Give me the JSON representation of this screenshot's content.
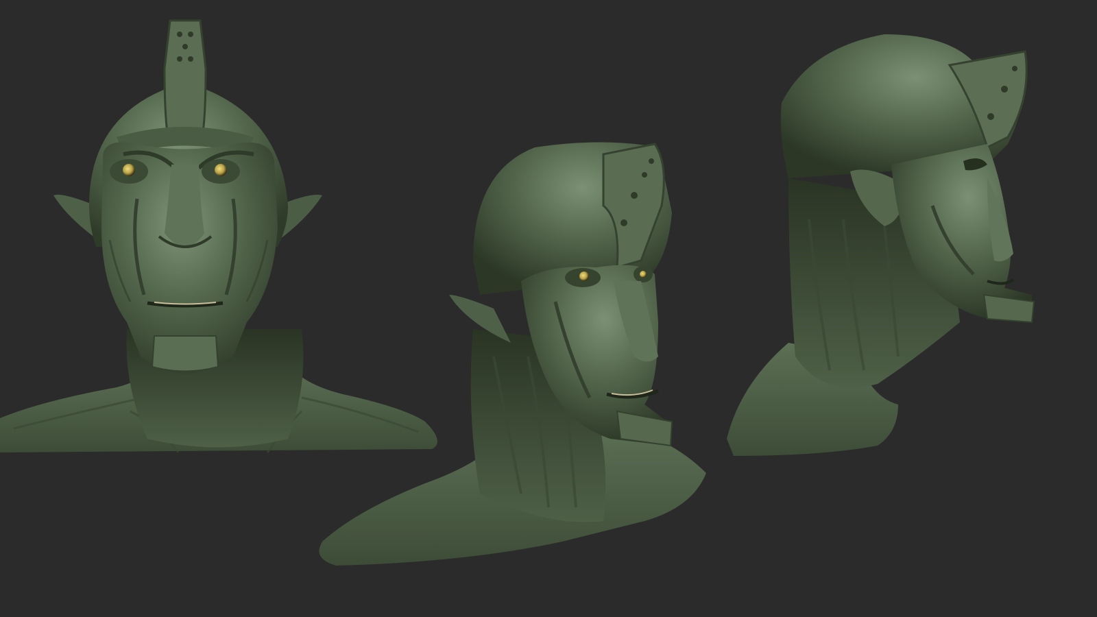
{
  "scene": {
    "background_color": "#2b2b2b",
    "clay_color": "#4f6148",
    "clay_highlight": "#7f9478",
    "clay_shadow": "#26301f",
    "eye_color": "#b8a24a",
    "views": [
      {
        "view": "front"
      },
      {
        "view": "three-quarter"
      },
      {
        "view": "side"
      }
    ]
  }
}
